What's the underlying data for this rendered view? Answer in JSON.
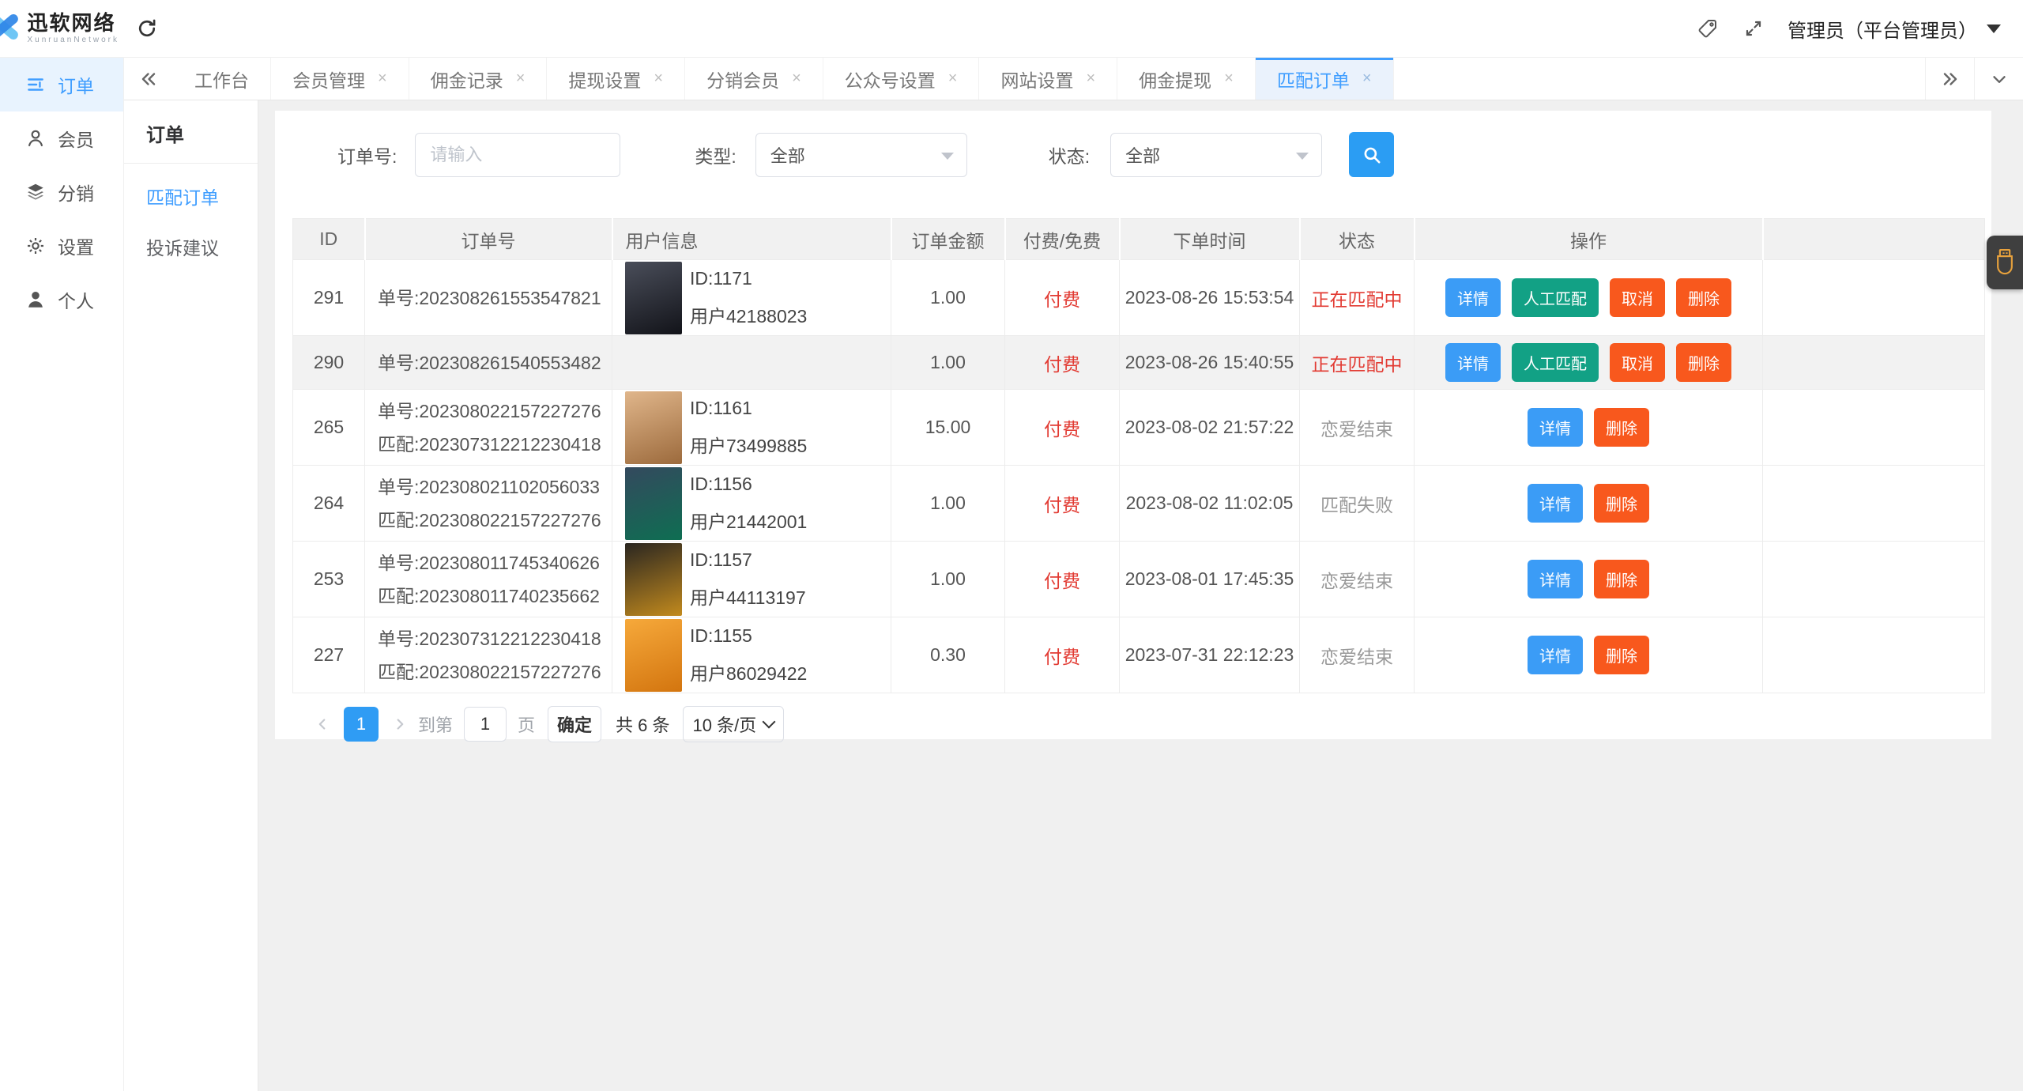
{
  "brand": {
    "name": "迅软网络",
    "subtitle": "XunruanNetwork"
  },
  "topbar": {
    "user": "管理员（平台管理员）"
  },
  "sidebar": {
    "items": [
      {
        "label": "订单",
        "icon": "order-list-icon",
        "active": true
      },
      {
        "label": "会员",
        "icon": "member-icon",
        "active": false
      },
      {
        "label": "分销",
        "icon": "distribution-layers-icon",
        "active": false
      },
      {
        "label": "设置",
        "icon": "settings-gear-icon",
        "active": false
      },
      {
        "label": "个人",
        "icon": "profile-person-icon",
        "active": false
      }
    ]
  },
  "tabs": {
    "items": [
      {
        "label": "工作台",
        "closable": false,
        "active": false
      },
      {
        "label": "会员管理",
        "closable": true,
        "active": false
      },
      {
        "label": "佣金记录",
        "closable": true,
        "active": false
      },
      {
        "label": "提现设置",
        "closable": true,
        "active": false
      },
      {
        "label": "分销会员",
        "closable": true,
        "active": false
      },
      {
        "label": "公众号设置",
        "closable": true,
        "active": false
      },
      {
        "label": "网站设置",
        "closable": true,
        "active": false
      },
      {
        "label": "佣金提现",
        "closable": true,
        "active": false
      },
      {
        "label": "匹配订单",
        "closable": true,
        "active": true
      }
    ]
  },
  "submenu": {
    "title": "订单",
    "items": [
      {
        "label": "匹配订单",
        "active": true
      },
      {
        "label": "投诉建议",
        "active": false
      }
    ]
  },
  "filters": {
    "order_no_label": "订单号:",
    "order_no_placeholder": "请输入",
    "type_label": "类型:",
    "type_value": "全部",
    "status_label": "状态:",
    "status_value": "全部"
  },
  "table": {
    "columns": [
      "ID",
      "订单号",
      "用户信息",
      "订单金额",
      "付费/免费",
      "下单时间",
      "状态",
      "操作",
      ""
    ],
    "rows": [
      {
        "id": "291",
        "order_lines": [
          "单号:202308261553547821"
        ],
        "user": {
          "id": "ID:1171",
          "name": "用户42188023",
          "avatar_from": "#4a4e5a",
          "avatar_to": "#121319"
        },
        "amount": "1.00",
        "fee": "付费",
        "time": "2023-08-26 15:53:54",
        "status": "正在匹配中",
        "status_type": "danger",
        "highlight": false,
        "actions": [
          {
            "label": "详情",
            "type": "info"
          },
          {
            "label": "人工匹配",
            "type": "success"
          },
          {
            "label": "取消",
            "type": "danger"
          },
          {
            "label": "删除",
            "type": "danger"
          }
        ]
      },
      {
        "id": "290",
        "order_lines": [
          "单号:202308261540553482"
        ],
        "user": null,
        "amount": "1.00",
        "fee": "付费",
        "time": "2023-08-26 15:40:55",
        "status": "正在匹配中",
        "status_type": "danger",
        "highlight": true,
        "actions": [
          {
            "label": "详情",
            "type": "info"
          },
          {
            "label": "人工匹配",
            "type": "success"
          },
          {
            "label": "取消",
            "type": "danger"
          },
          {
            "label": "删除",
            "type": "danger"
          }
        ]
      },
      {
        "id": "265",
        "order_lines": [
          "单号:202308022157227276",
          "匹配:202307312212230418"
        ],
        "user": {
          "id": "ID:1161",
          "name": "用户73499885",
          "avatar_from": "#e0b68b",
          "avatar_to": "#9c6a3c"
        },
        "amount": "15.00",
        "fee": "付费",
        "time": "2023-08-02 21:57:22",
        "status": "恋爱结束",
        "status_type": "muted",
        "highlight": false,
        "actions": [
          {
            "label": "详情",
            "type": "info"
          },
          {
            "label": "删除",
            "type": "danger"
          }
        ]
      },
      {
        "id": "264",
        "order_lines": [
          "单号:202308021102056033",
          "匹配:202308022157227276"
        ],
        "user": {
          "id": "ID:1156",
          "name": "用户21442001",
          "avatar_from": "#34495e",
          "avatar_to": "#0e6e52"
        },
        "amount": "1.00",
        "fee": "付费",
        "time": "2023-08-02 11:02:05",
        "status": "匹配失败",
        "status_type": "muted",
        "highlight": false,
        "actions": [
          {
            "label": "详情",
            "type": "info"
          },
          {
            "label": "删除",
            "type": "danger"
          }
        ]
      },
      {
        "id": "253",
        "order_lines": [
          "单号:202308011745340626",
          "匹配:202308011740235662"
        ],
        "user": {
          "id": "ID:1157",
          "name": "用户44113197",
          "avatar_from": "#2a2620",
          "avatar_to": "#c28a1e"
        },
        "amount": "1.00",
        "fee": "付费",
        "time": "2023-08-01 17:45:35",
        "status": "恋爱结束",
        "status_type": "muted",
        "highlight": false,
        "actions": [
          {
            "label": "详情",
            "type": "info"
          },
          {
            "label": "删除",
            "type": "danger"
          }
        ]
      },
      {
        "id": "227",
        "order_lines": [
          "单号:202307312212230418",
          "匹配:202308022157227276"
        ],
        "user": {
          "id": "ID:1155",
          "name": "用户86029422",
          "avatar_from": "#f6a93b",
          "avatar_to": "#d3750f"
        },
        "amount": "0.30",
        "fee": "付费",
        "time": "2023-07-31 22:12:23",
        "status": "恋爱结束",
        "status_type": "muted",
        "highlight": false,
        "actions": [
          {
            "label": "详情",
            "type": "info"
          },
          {
            "label": "删除",
            "type": "danger"
          }
        ]
      }
    ]
  },
  "pagination": {
    "goto_label": "到第",
    "goto_value": "1",
    "page": "1",
    "page_label": "页",
    "confirm_label": "确定",
    "total_label": "共 6 条",
    "per_page": "10 条/页"
  },
  "colors": {
    "accent": "#409EFF",
    "success": "#12a185",
    "danger": "#f8581d",
    "red_text": "#e23b33"
  }
}
